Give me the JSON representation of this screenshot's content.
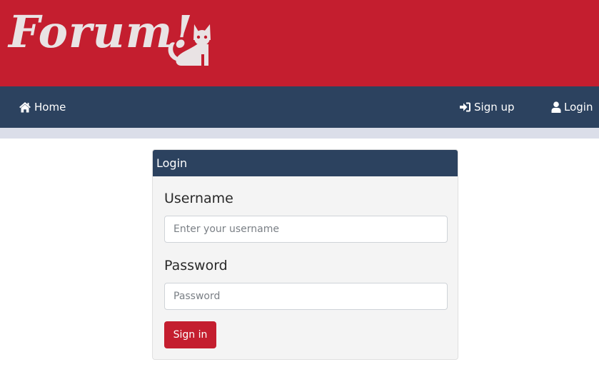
{
  "header": {
    "logo_text": "Forum!",
    "logo_icon": "cat-icon",
    "background_color": "#c41e2f"
  },
  "navbar": {
    "background_color": "#2c425f",
    "home": {
      "label": "Home",
      "icon": "home-icon"
    },
    "signup": {
      "label": "Sign up",
      "icon": "sign-in-arrow-icon"
    },
    "login": {
      "label": "Login",
      "icon": "user-icon"
    }
  },
  "login_card": {
    "title": "Login",
    "username": {
      "label": "Username",
      "placeholder": "Enter your username",
      "value": ""
    },
    "password": {
      "label": "Password",
      "placeholder": "Password",
      "value": ""
    },
    "submit_label": "Sign in",
    "accent_color": "#c41e2f"
  }
}
